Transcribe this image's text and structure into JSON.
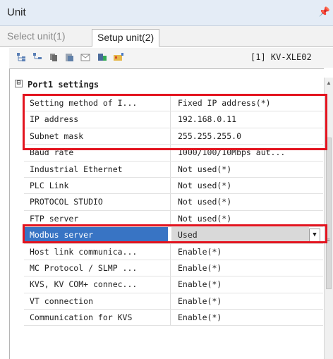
{
  "window": {
    "title": "Unit",
    "pin_icon": "pin-icon"
  },
  "tabs": [
    {
      "label": "Select unit(1)",
      "active": false
    },
    {
      "label": "Setup unit(2)",
      "active": true
    }
  ],
  "toolbar": {
    "icons": [
      "tree-expand-icon",
      "tree-collapse-icon",
      "copy-icon",
      "paste-icon",
      "mail-icon",
      "device-icon",
      "settings-icon"
    ],
    "unit_ref": "[1] KV-XLE02"
  },
  "section": {
    "expander": "⊟",
    "label": "Port1 settings"
  },
  "rows": [
    {
      "name": "Setting method of I...",
      "value": "Fixed IP address(*)"
    },
    {
      "name": "IP address",
      "value": "192.168.0.11"
    },
    {
      "name": "Subnet mask",
      "value": "255.255.255.0"
    },
    {
      "name": "Baud rate",
      "value": "1000/100/10Mbps aut..."
    },
    {
      "name": "Industrial Ethernet",
      "value": "Not used(*)"
    },
    {
      "name": "PLC Link",
      "value": "Not used(*)"
    },
    {
      "name": "PROTOCOL STUDIO",
      "value": "Not used(*)"
    },
    {
      "name": "FTP server",
      "value": "Not used(*)"
    },
    {
      "name": "Modbus server",
      "value": "Used",
      "selected": true
    },
    {
      "name": "Host link communica...",
      "value": "Enable(*)"
    },
    {
      "name": "MC Protocol / SLMP ...",
      "value": "Enable(*)"
    },
    {
      "name": "KVS, KV COM+ connec...",
      "value": "Enable(*)"
    },
    {
      "name": "VT connection",
      "value": "Enable(*)"
    },
    {
      "name": "Communication for KVS",
      "value": "Enable(*)"
    }
  ],
  "colors": {
    "highlight": "#e3141f",
    "selection": "#3874c4"
  }
}
